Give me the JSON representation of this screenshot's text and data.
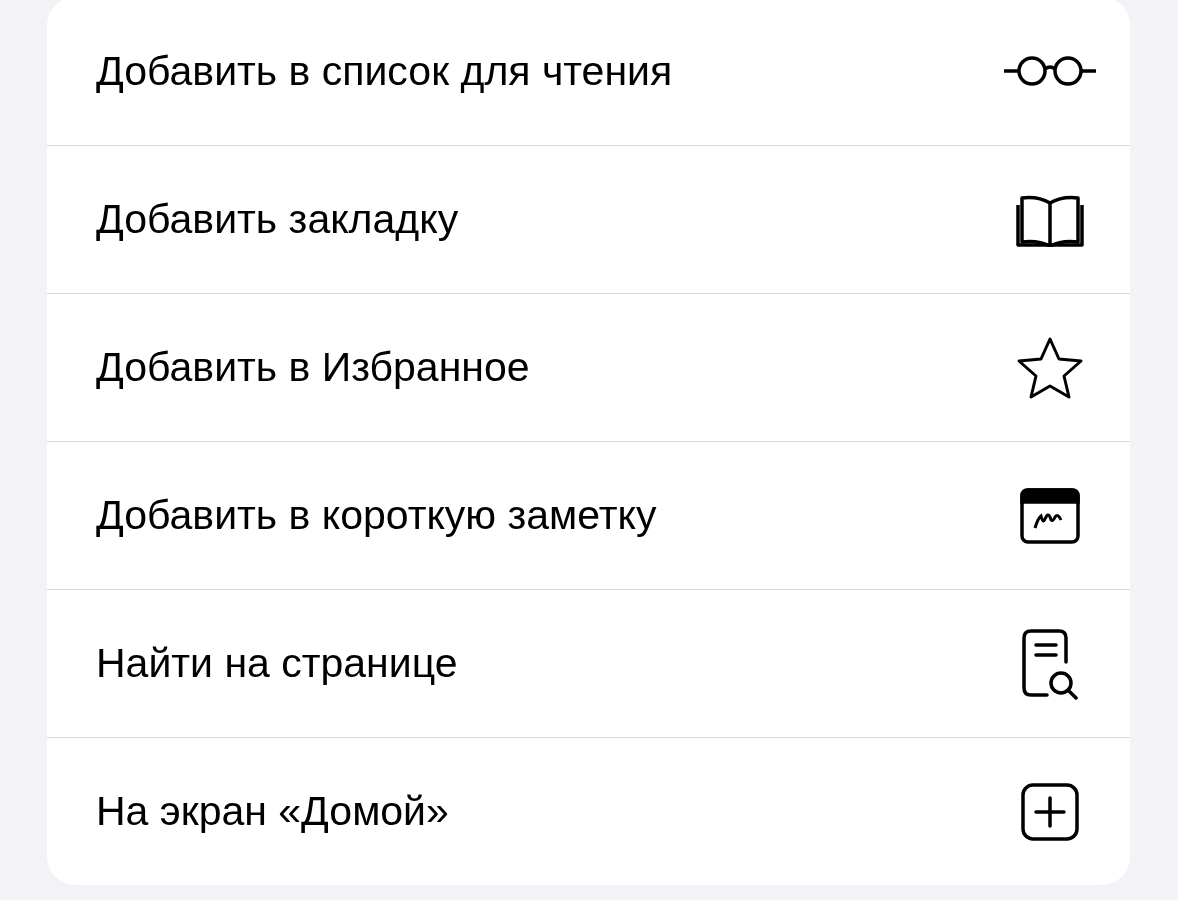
{
  "menu": {
    "items": [
      {
        "label": "Добавить в список для чтения",
        "kind": "glasses"
      },
      {
        "label": "Добавить закладку",
        "kind": "book"
      },
      {
        "label": "Добавить в Избранное",
        "kind": "star"
      },
      {
        "label": "Добавить в короткую заметку",
        "kind": "note"
      },
      {
        "label": "Найти на странице",
        "kind": "find"
      },
      {
        "label": "На экран «Домой»",
        "kind": "plus"
      }
    ]
  }
}
